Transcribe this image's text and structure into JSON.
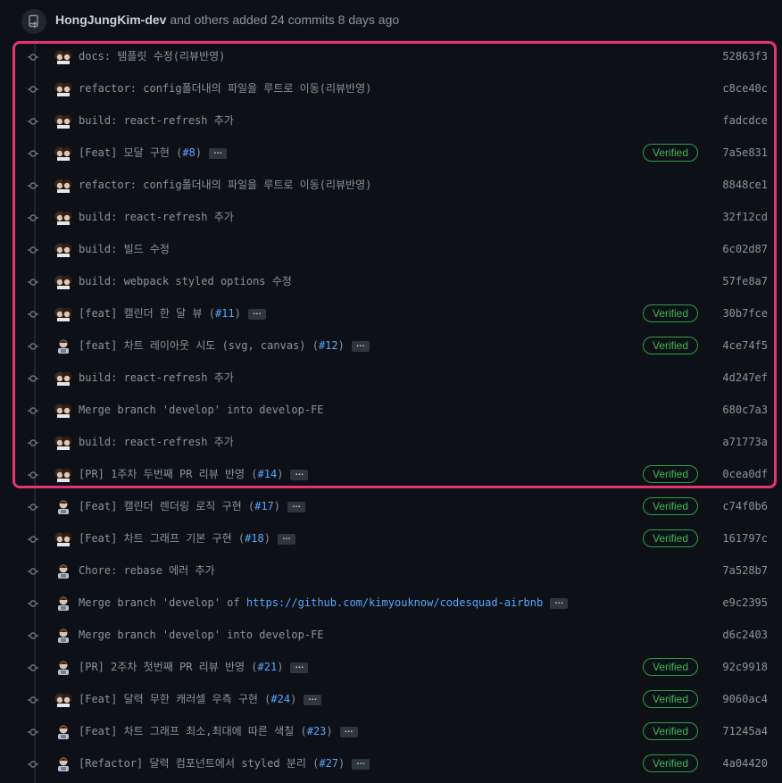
{
  "header": {
    "author": "HongJungKim-dev",
    "summary": "and others added 24 commits 8 days ago"
  },
  "colors": {
    "background": "#0d1117",
    "highlight_border": "#e8336d",
    "verified_green": "#3fb950",
    "link_blue": "#58a6ff"
  },
  "verified_label": "Verified",
  "commits": [
    {
      "avatar": "hongjungkim-avatar",
      "msg": "docs: 템플릿 수정(리뷰반영)",
      "link": "",
      "ref": "",
      "ellipsis": false,
      "verified": false,
      "sha": "52863f3"
    },
    {
      "avatar": "hongjungkim-avatar",
      "msg": "refactor: config폴더내의 파일을 루트로 이동(리뷰반영)",
      "link": "",
      "ref": "",
      "ellipsis": false,
      "verified": false,
      "sha": "c8ce40c"
    },
    {
      "avatar": "hongjungkim-avatar",
      "msg": "build: react-refresh 추가",
      "link": "",
      "ref": "",
      "ellipsis": false,
      "verified": false,
      "sha": "fadcdce"
    },
    {
      "avatar": "hongjungkim-avatar",
      "msg": "[Feat] 모달 구현 (",
      "link": "",
      "ref": "#8",
      "ellipsis": true,
      "verified": true,
      "sha": "7a5e831"
    },
    {
      "avatar": "hongjungkim-avatar",
      "msg": "refactor: config폴더내의 파일을 루트로 이동(리뷰반영)",
      "link": "",
      "ref": "",
      "ellipsis": false,
      "verified": false,
      "sha": "8848ce1"
    },
    {
      "avatar": "hongjungkim-avatar",
      "msg": "build: react-refresh 추가",
      "link": "",
      "ref": "",
      "ellipsis": false,
      "verified": false,
      "sha": "32f12cd"
    },
    {
      "avatar": "hongjungkim-avatar",
      "msg": "build: 빌드 수정",
      "link": "",
      "ref": "",
      "ellipsis": false,
      "verified": false,
      "sha": "6c02d87"
    },
    {
      "avatar": "hongjungkim-avatar",
      "msg": "build: webpack styled options 수정",
      "link": "",
      "ref": "",
      "ellipsis": false,
      "verified": false,
      "sha": "57fe8a7"
    },
    {
      "avatar": "hongjungkim-avatar",
      "msg": "[feat] 캘린더 한 달 뷰 (",
      "link": "",
      "ref": "#11",
      "ellipsis": true,
      "verified": true,
      "sha": "30b7fce"
    },
    {
      "avatar": "kimyouknow-avatar",
      "msg": "[feat] 차트 레이아웃 시도 (svg, canvas) (",
      "link": "",
      "ref": "#12",
      "ellipsis": true,
      "verified": true,
      "sha": "4ce74f5"
    },
    {
      "avatar": "hongjungkim-avatar",
      "msg": "build: react-refresh 추가",
      "link": "",
      "ref": "",
      "ellipsis": false,
      "verified": false,
      "sha": "4d247ef"
    },
    {
      "avatar": "hongjungkim-avatar",
      "msg": "Merge branch 'develop' into develop-FE",
      "link": "",
      "ref": "",
      "ellipsis": false,
      "verified": false,
      "sha": "680c7a3"
    },
    {
      "avatar": "hongjungkim-avatar",
      "msg": "build: react-refresh 추가",
      "link": "",
      "ref": "",
      "ellipsis": false,
      "verified": false,
      "sha": "a71773a"
    },
    {
      "avatar": "hongjungkim-avatar",
      "msg": "[PR] 1주차 두번째 PR 리뷰 반영 (",
      "link": "",
      "ref": "#14",
      "ellipsis": true,
      "verified": true,
      "sha": "0cea0df"
    },
    {
      "avatar": "kimyouknow-avatar",
      "msg": "[Feat] 캘린더 렌더링 로직 구현 (",
      "link": "",
      "ref": "#17",
      "ellipsis": true,
      "verified": true,
      "sha": "c74f0b6"
    },
    {
      "avatar": "hongjungkim-avatar",
      "msg": "[Feat] 차트 그래프 기본 구현 (",
      "link": "",
      "ref": "#18",
      "ellipsis": true,
      "verified": true,
      "sha": "161797c"
    },
    {
      "avatar": "kimyouknow-avatar",
      "msg": "Chore: rebase 에러 추가",
      "link": "",
      "ref": "",
      "ellipsis": false,
      "verified": false,
      "sha": "7a528b7"
    },
    {
      "avatar": "kimyouknow-avatar",
      "msg": "Merge branch 'develop' of ",
      "link": "https://github.com/kimyouknow/codesquad-airbnb",
      "ref": "",
      "ellipsis": true,
      "verified": false,
      "sha": "e9c2395"
    },
    {
      "avatar": "kimyouknow-avatar",
      "msg": "Merge branch 'develop' into develop-FE",
      "link": "",
      "ref": "",
      "ellipsis": false,
      "verified": false,
      "sha": "d6c2403"
    },
    {
      "avatar": "kimyouknow-avatar",
      "msg": "[PR] 2주차 첫번째 PR 리뷰 반영 (",
      "link": "",
      "ref": "#21",
      "ellipsis": true,
      "verified": true,
      "sha": "92c9918"
    },
    {
      "avatar": "hongjungkim-avatar",
      "msg": "[Feat] 달력 무한 캐러셀 우측 구현 (",
      "link": "",
      "ref": "#24",
      "ellipsis": true,
      "verified": true,
      "sha": "9060ac4"
    },
    {
      "avatar": "kimyouknow-avatar",
      "msg": "[Feat] 차트 그래프 최소,최대에 따른 색칠 (",
      "link": "",
      "ref": "#23",
      "ellipsis": true,
      "verified": true,
      "sha": "71245a4"
    },
    {
      "avatar": "kimyouknow-avatar",
      "msg": "[Refactor] 달력 컴포넌트에서 styled 분리 (",
      "link": "",
      "ref": "#27",
      "ellipsis": true,
      "verified": true,
      "sha": "4a04420"
    }
  ]
}
